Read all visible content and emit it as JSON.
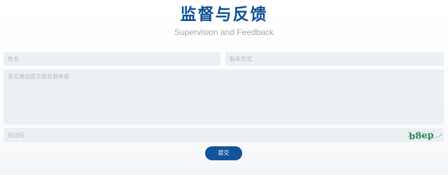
{
  "header": {
    "title": "监督与反馈",
    "subtitle": "Supervision and Feedback"
  },
  "form": {
    "name_placeholder": "姓名",
    "contact_placeholder": "联系方式",
    "message_placeholder": "意见建议提交和监督举报",
    "captcha_placeholder": "验证码",
    "captcha_text": "b8ep",
    "submit_label": "提交"
  },
  "colors": {
    "accent": "#0d4f96",
    "button": "#12549b",
    "field_bg": "#edf0f3",
    "captcha_text": "#2e8b57"
  },
  "icons": {
    "captcha": "captcha-image"
  }
}
